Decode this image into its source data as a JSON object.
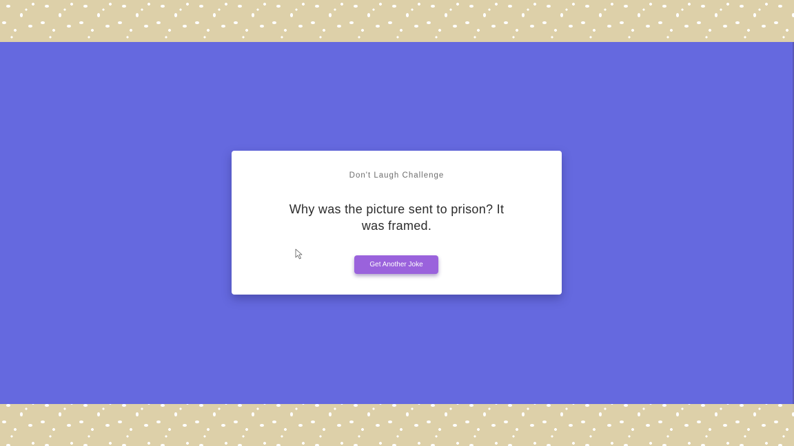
{
  "card": {
    "title": "Don't Laugh Challenge",
    "joke": "Why was the picture sent to prison? It was framed.",
    "button_label": "Get Another Joke"
  },
  "colors": {
    "border_pattern": "#ddd0a9",
    "background": "#6569df",
    "card": "#ffffff",
    "button": "#9a62dc",
    "button_text": "#ffffff",
    "title_text": "#6d6d6d",
    "joke_text": "#2b2b2b"
  },
  "icons": {
    "pointer": "mouse-pointer-icon"
  }
}
